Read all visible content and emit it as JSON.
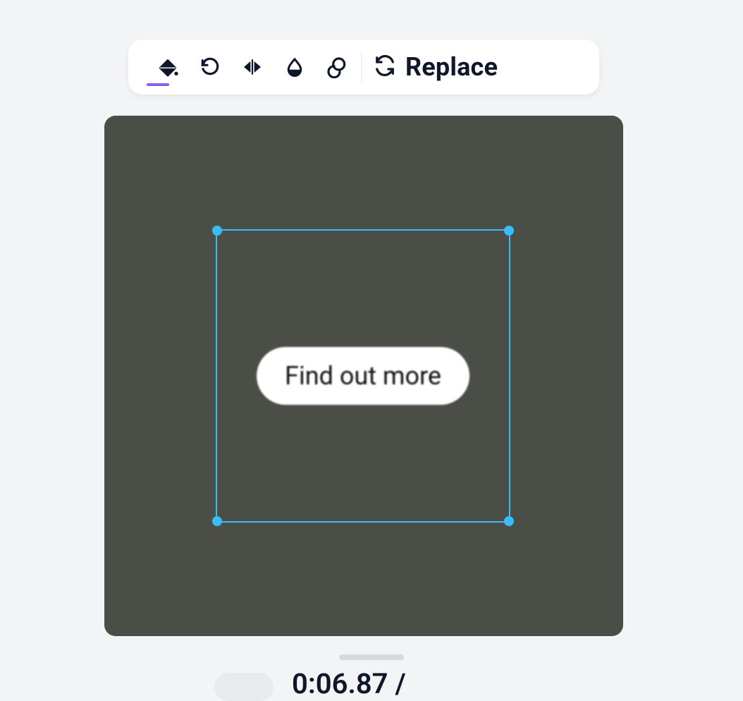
{
  "toolbar": {
    "replace_label": "Replace",
    "icons": {
      "fill": "paint-bucket-icon",
      "rotate": "rotate-ccw-icon",
      "flip": "flip-horizontal-icon",
      "contrast": "droplet-half-icon",
      "layers": "layers-icon",
      "swap": "sync-icon"
    }
  },
  "canvas": {
    "clip_label": "Find out more"
  },
  "timeline": {
    "time_partial": "0:06.87 /"
  }
}
